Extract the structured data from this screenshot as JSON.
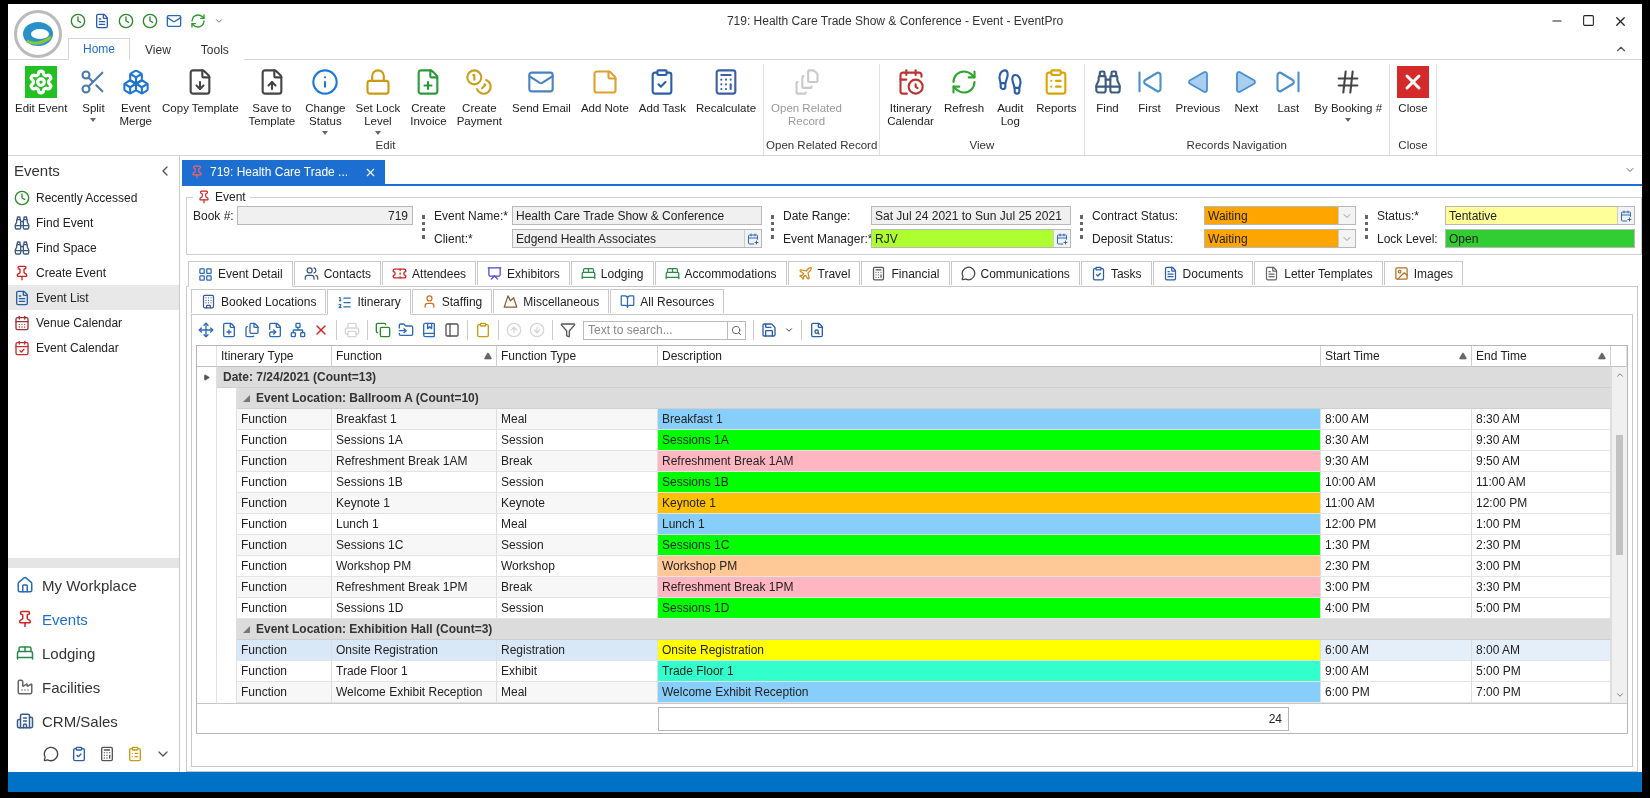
{
  "window": {
    "title": "719: Health Care Trade Show & Conference - Event - EventPro"
  },
  "ribbon_tabs": [
    {
      "label": "Home",
      "selected": true
    },
    {
      "label": "View",
      "selected": false
    },
    {
      "label": "Tools",
      "selected": false
    }
  ],
  "ribbon_groups": [
    {
      "title": "Edit",
      "buttons": [
        {
          "lines": [
            "Edit Event"
          ],
          "dropdown": false,
          "disabled": false
        },
        {
          "lines": [
            "Split"
          ],
          "dropdown": true,
          "disabled": false
        },
        {
          "lines": [
            "Event",
            "Merge"
          ],
          "dropdown": false,
          "disabled": false
        },
        {
          "lines": [
            "Copy Template"
          ],
          "dropdown": false,
          "disabled": false
        },
        {
          "lines": [
            "Save to",
            "Template"
          ],
          "dropdown": false,
          "disabled": false
        },
        {
          "lines": [
            "Change",
            "Status"
          ],
          "dropdown": true,
          "disabled": false
        },
        {
          "lines": [
            "Set Lock",
            "Level"
          ],
          "dropdown": true,
          "disabled": false
        },
        {
          "lines": [
            "Create",
            "Invoice"
          ],
          "dropdown": false,
          "disabled": false
        },
        {
          "lines": [
            "Create",
            "Payment"
          ],
          "dropdown": false,
          "disabled": false
        },
        {
          "lines": [
            "Send Email"
          ],
          "dropdown": false,
          "disabled": false
        },
        {
          "lines": [
            "Add Note"
          ],
          "dropdown": false,
          "disabled": false
        },
        {
          "lines": [
            "Add Task"
          ],
          "dropdown": false,
          "disabled": false
        },
        {
          "lines": [
            "Recalculate"
          ],
          "dropdown": false,
          "disabled": false
        }
      ]
    },
    {
      "title": "Open Related Record",
      "buttons": [
        {
          "lines": [
            "Open Related",
            "Record"
          ],
          "dropdown": false,
          "disabled": true
        }
      ]
    },
    {
      "title": "View",
      "buttons": [
        {
          "lines": [
            "Itinerary",
            "Calendar"
          ],
          "dropdown": false,
          "disabled": false
        },
        {
          "lines": [
            "Refresh"
          ],
          "dropdown": false,
          "disabled": false
        },
        {
          "lines": [
            "Audit",
            "Log"
          ],
          "dropdown": false,
          "disabled": false
        },
        {
          "lines": [
            "Reports"
          ],
          "dropdown": false,
          "disabled": false
        }
      ]
    },
    {
      "title": "Records Navigation",
      "buttons": [
        {
          "lines": [
            "Find"
          ],
          "dropdown": false,
          "disabled": false
        },
        {
          "lines": [
            "First"
          ],
          "dropdown": false,
          "disabled": false
        },
        {
          "lines": [
            "Previous"
          ],
          "dropdown": false,
          "disabled": false
        },
        {
          "lines": [
            "Next"
          ],
          "dropdown": false,
          "disabled": false
        },
        {
          "lines": [
            "Last"
          ],
          "dropdown": false,
          "disabled": false
        },
        {
          "lines": [
            "By Booking #"
          ],
          "dropdown": true,
          "disabled": false
        }
      ]
    },
    {
      "title": "Close",
      "buttons": [
        {
          "lines": [
            "Close"
          ],
          "dropdown": false,
          "disabled": false
        }
      ]
    }
  ],
  "sidebar": {
    "title": "Events",
    "items": [
      {
        "label": "Recently Accessed",
        "selected": false
      },
      {
        "label": "Find Event",
        "selected": false
      },
      {
        "label": "Find Space",
        "selected": false
      },
      {
        "label": "Create Event",
        "selected": false
      },
      {
        "label": "Event List",
        "selected": true
      },
      {
        "label": "Venue Calendar",
        "selected": false
      },
      {
        "label": "Event Calendar",
        "selected": false
      }
    ],
    "modules": [
      {
        "label": "My Workplace",
        "selected": false
      },
      {
        "label": "Events",
        "selected": true
      },
      {
        "label": "Lodging",
        "selected": false
      },
      {
        "label": "Facilities",
        "selected": false
      },
      {
        "label": "CRM/Sales",
        "selected": false
      }
    ]
  },
  "document_tab": {
    "label": "719: Health Care Trade ..."
  },
  "event": {
    "title": "Event",
    "book": {
      "label": "Book #:",
      "value": "719"
    },
    "event_name": {
      "label": "Event Name:*",
      "value": "Health Care Trade Show & Conference"
    },
    "client": {
      "label": "Client:*",
      "value": "Edgend Health Associates"
    },
    "date_range": {
      "label": "Date Range:",
      "value": "Sat Jul 24 2021 to Sun Jul 25 2021"
    },
    "event_manager": {
      "label": "Event Manager:*",
      "value": "RJV",
      "color": "#adff2f"
    },
    "contract_status": {
      "label": "Contract Status:",
      "value": "Waiting",
      "color": "#ffa500"
    },
    "deposit_status": {
      "label": "Deposit Status:",
      "value": "Waiting",
      "color": "#ffa500"
    },
    "status": {
      "label": "Status:*",
      "value": "Tentative",
      "color": "#ffff99"
    },
    "lock_level": {
      "label": "Lock Level:",
      "value": "Open",
      "color": "#32cd32"
    }
  },
  "tabs": [
    {
      "label": "Event Detail",
      "selected": true
    },
    {
      "label": "Contacts",
      "selected": false
    },
    {
      "label": "Attendees",
      "selected": false
    },
    {
      "label": "Exhibitors",
      "selected": false
    },
    {
      "label": "Lodging",
      "selected": false
    },
    {
      "label": "Accommodations",
      "selected": false
    },
    {
      "label": "Travel",
      "selected": false
    },
    {
      "label": "Financial",
      "selected": false
    },
    {
      "label": "Communications",
      "selected": false
    },
    {
      "label": "Tasks",
      "selected": false
    },
    {
      "label": "Documents",
      "selected": false
    },
    {
      "label": "Letter Templates",
      "selected": false
    },
    {
      "label": "Images",
      "selected": false
    }
  ],
  "sub_tabs": [
    {
      "label": "Booked Locations",
      "selected": false
    },
    {
      "label": "Itinerary",
      "selected": true
    },
    {
      "label": "Staffing",
      "selected": false
    },
    {
      "label": "Miscellaneous",
      "selected": false
    },
    {
      "label": "All Resources",
      "selected": false
    }
  ],
  "search": {
    "placeholder": "Text to search..."
  },
  "grid": {
    "columns": [
      {
        "label": "Itinerary Type",
        "sorted": false
      },
      {
        "label": "Function",
        "sorted": true
      },
      {
        "label": "Function Type",
        "sorted": false
      },
      {
        "label": "Description",
        "sorted": false
      },
      {
        "label": "Start Time",
        "sorted": true
      },
      {
        "label": "End Time",
        "sorted": true
      }
    ],
    "groups": [
      {
        "label": "Date: 7/24/2021 (Count=13)",
        "current": true,
        "children": [
          {
            "label": "Event Location: Ballroom A (Count=10)",
            "expanded": true,
            "rows": [
              {
                "type": "Function",
                "function": "Breakfast 1",
                "function_type": "Meal",
                "description": "Breakfast 1",
                "color": "#87cefa",
                "start": "8:00 AM",
                "end": "8:30 AM",
                "selected": false
              },
              {
                "type": "Function",
                "function": "Sessions 1A",
                "function_type": "Session",
                "description": "Sessions 1A",
                "color": "#00ff00",
                "start": "8:30 AM",
                "end": "9:30 AM",
                "selected": false
              },
              {
                "type": "Function",
                "function": "Refreshment Break 1AM",
                "function_type": "Break",
                "description": "Refreshment Break 1AM",
                "color": "#ffb6c1",
                "start": "9:30 AM",
                "end": "9:50 AM",
                "selected": false
              },
              {
                "type": "Function",
                "function": "Sessions 1B",
                "function_type": "Session",
                "description": "Sessions 1B",
                "color": "#00ff00",
                "start": "10:00 AM",
                "end": "11:00 AM",
                "selected": false
              },
              {
                "type": "Function",
                "function": "Keynote 1",
                "function_type": "Keynote",
                "description": "Keynote 1",
                "color": "#ffc000",
                "start": "11:00 AM",
                "end": "12:00 PM",
                "selected": false
              },
              {
                "type": "Function",
                "function": "Lunch 1",
                "function_type": "Meal",
                "description": "Lunch 1",
                "color": "#87cefa",
                "start": "12:00 PM",
                "end": "1:00 PM",
                "selected": false
              },
              {
                "type": "Function",
                "function": "Sessions 1C",
                "function_type": "Session",
                "description": "Sessions 1C",
                "color": "#00ff00",
                "start": "1:30 PM",
                "end": "2:30 PM",
                "selected": false
              },
              {
                "type": "Function",
                "function": "Workshop PM",
                "function_type": "Workshop",
                "description": "Workshop PM",
                "color": "#ffc896",
                "start": "2:30 PM",
                "end": "3:00 PM",
                "selected": false
              },
              {
                "type": "Function",
                "function": "Refreshment Break 1PM",
                "function_type": "Break",
                "description": "Refreshment Break 1PM",
                "color": "#ffb6c1",
                "start": "3:00 PM",
                "end": "3:30 PM",
                "selected": false
              },
              {
                "type": "Function",
                "function": "Sessions 1D",
                "function_type": "Session",
                "description": "Sessions 1D",
                "color": "#00ff00",
                "start": "4:00 PM",
                "end": "5:00 PM",
                "selected": false
              }
            ]
          },
          {
            "label": "Event Location: Exhibition Hall (Count=3)",
            "expanded": true,
            "rows": [
              {
                "type": "Function",
                "function": "Onsite Registration",
                "function_type": "Registration",
                "description": "Onsite Registration",
                "color": "#ffff00",
                "start": "6:00 AM",
                "end": "8:00 AM",
                "selected": true
              },
              {
                "type": "Function",
                "function": "Trade Floor 1",
                "function_type": "Exhibit",
                "description": "Trade Floor 1",
                "color": "#33ffcc",
                "start": "9:00 AM",
                "end": "5:00 PM",
                "selected": false
              },
              {
                "type": "Function",
                "function": "Welcome Exhibit Reception",
                "function_type": "Meal",
                "description": "Welcome Exhibit Reception",
                "color": "#87cefa",
                "start": "6:00 PM",
                "end": "7:00 PM",
                "selected": false
              }
            ]
          }
        ]
      }
    ],
    "total": "24"
  }
}
